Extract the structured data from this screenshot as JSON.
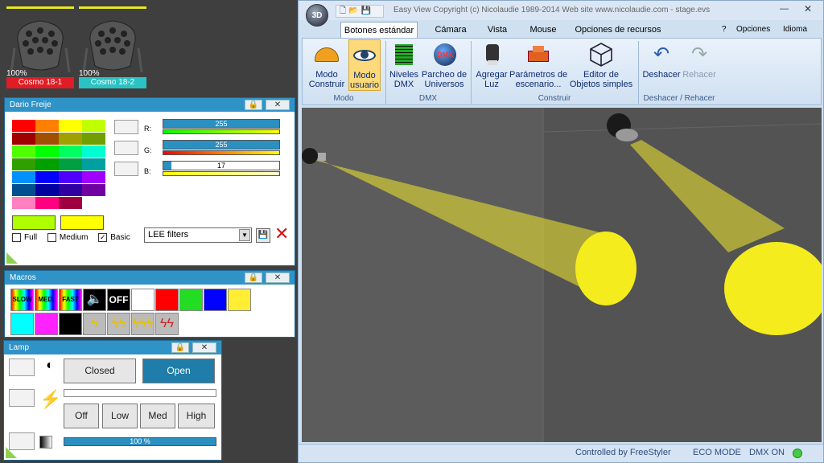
{
  "fixtures": [
    {
      "percent": "100%",
      "name": "Cosmo 18-1",
      "color": "#e11c24"
    },
    {
      "percent": "100%",
      "name": "Cosmo 18-2",
      "color": "#29c3c3"
    }
  ],
  "color_panel": {
    "title": "Dario Freije",
    "r_label": "R:",
    "g_label": "G:",
    "b_label": "B:",
    "r_value": "255",
    "g_value": "255",
    "b_value": "17",
    "filter_select": "LEE filters",
    "opt_full": "Full",
    "opt_medium": "Medium",
    "opt_basic": "Basic",
    "palette": [
      "#ff0000",
      "#ff8000",
      "#ffff00",
      "#c0ff00",
      "#a00000",
      "#a05000",
      "#a0a000",
      "#70a000",
      "#50ff00",
      "#00ff00",
      "#00ff60",
      "#00ffd0",
      "#30a000",
      "#00a000",
      "#00a040",
      "#00a0a0",
      "#0090ff",
      "#0000ff",
      "#5000ff",
      "#a000ff",
      "#005090",
      "#0000a0",
      "#3000a0",
      "#7000a0",
      "#ff80c0",
      "#ff0080",
      "#a00040",
      "#ffffff"
    ],
    "preview_a": "#b0ff00",
    "preview_b": "#ffff00"
  },
  "macros": {
    "title": "Macros",
    "labels": [
      "SLOW",
      "MED.",
      "FAST",
      "OFF"
    ],
    "colors": [
      "#ffffff",
      "#ff0000",
      "#22dd22",
      "#0000ff",
      "#ffee33",
      "#00ffff",
      "#ff22ff",
      "#000000"
    ]
  },
  "lamp": {
    "title": "Lamp",
    "closed": "Closed",
    "open": "Open",
    "off": "Off",
    "low": "Low",
    "med": "Med",
    "high": "High",
    "dimmer": "100 %"
  },
  "app": {
    "title": "Easy View   Copyright (c) Nicolaudie 1989-2014    Web site www.nicolaudie.com - stage.evs",
    "tabs": [
      "Botones estándar",
      "Cámara",
      "Vista",
      "Mouse",
      "Opciones de recursos"
    ],
    "right_menu": [
      "?",
      "Opciones",
      "Idioma"
    ],
    "ribbon": {
      "modo_construir": "Modo\nConstruir",
      "modo_usuario": "Modo\nusuario",
      "niveles": "Niveles\nDMX",
      "parcheo": "Parcheo de\nUniversos",
      "agregar": "Agregar\nLuz",
      "parametros": "Parámetros de\nescenario...",
      "editor": "Editor de\nObjetos simples",
      "deshacer": "Deshacer",
      "rehacer": "Rehacer",
      "groups": [
        "Modo",
        "DMX",
        "Construir",
        "Deshacer / Rehacer"
      ]
    },
    "status": [
      "Controlled by FreeStyler",
      "ECO MODE",
      "DMX ON"
    ]
  }
}
